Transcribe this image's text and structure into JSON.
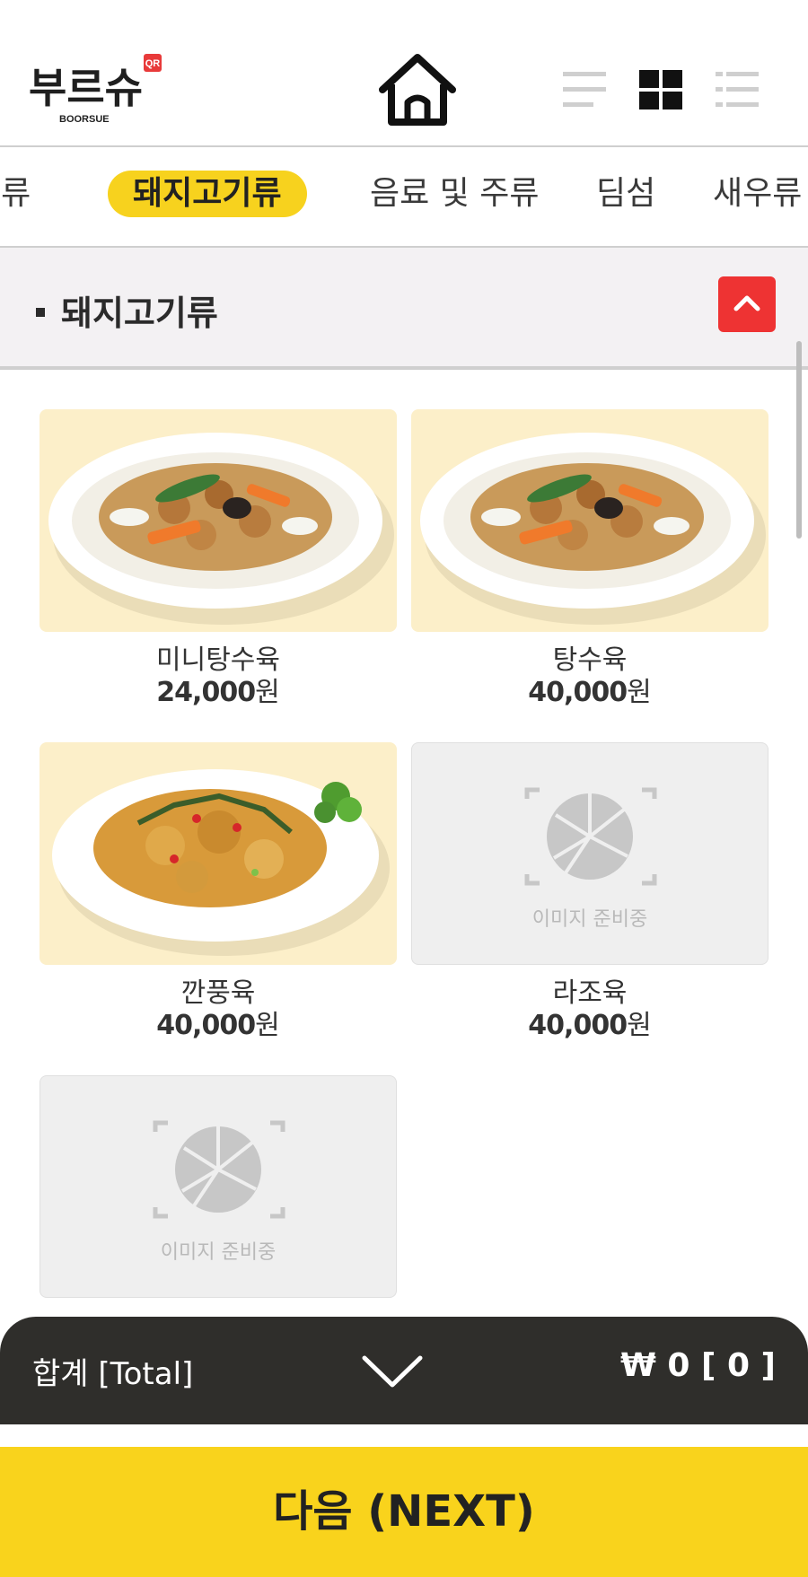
{
  "header": {
    "logo_text": "부르슈",
    "logo_sub": "BOORSUE",
    "logo_badge": "QR"
  },
  "tabs": [
    {
      "label": "면류",
      "active": false
    },
    {
      "label": "돼지고기류",
      "active": true
    },
    {
      "label": "음료 및 주류",
      "active": false
    },
    {
      "label": "딤섬",
      "active": false
    },
    {
      "label": "새우류",
      "active": false
    }
  ],
  "section": {
    "title": "돼지고기류"
  },
  "items": [
    {
      "name": "미니탕수육",
      "price": "24,000",
      "currency": "원",
      "image": "photo"
    },
    {
      "name": "탕수육",
      "price": "40,000",
      "currency": "원",
      "image": "photo"
    },
    {
      "name": "깐풍육",
      "price": "40,000",
      "currency": "원",
      "image": "photo"
    },
    {
      "name": "라조육",
      "price": "40,000",
      "currency": "원",
      "image": "placeholder",
      "placeholder_text": "이미지 준비중"
    },
    {
      "name": "",
      "price": "",
      "currency": "",
      "image": "placeholder",
      "placeholder_text": "이미지 준비중"
    }
  ],
  "total": {
    "label": "합계 [Total]",
    "value": "₩ 0 [ 0 ]"
  },
  "next_button": "다음 (NEXT)",
  "colors": {
    "accent": "#f9d31c",
    "collapse": "#ee3333",
    "total_bar": "#2f2e2b"
  }
}
